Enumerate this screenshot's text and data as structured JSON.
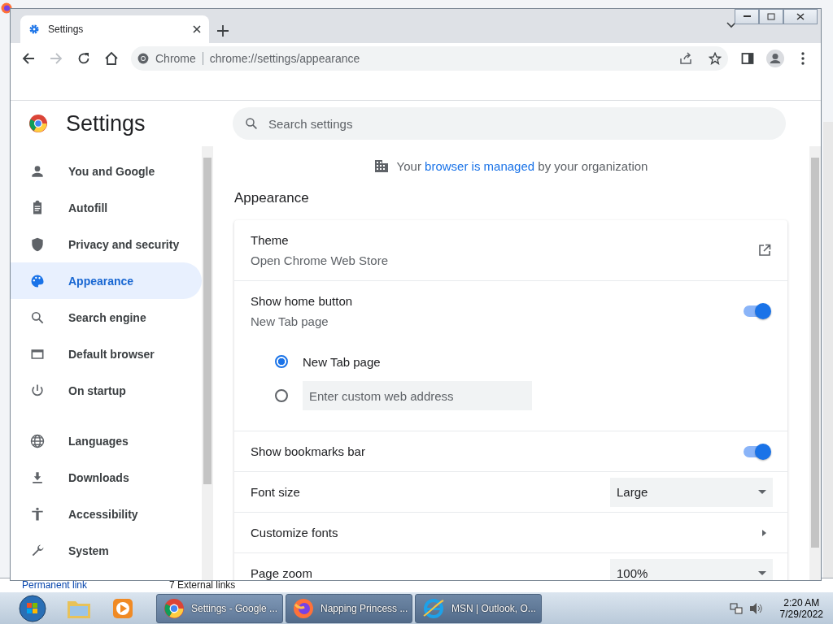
{
  "background_window": {
    "footer_links": [
      "Permanent link",
      "7  External links"
    ]
  },
  "browser": {
    "tab": {
      "title": "Settings"
    },
    "omnibox": {
      "site_label": "Chrome",
      "url": "chrome://settings/appearance"
    }
  },
  "settings": {
    "title": "Settings",
    "search": {
      "placeholder": "Search settings"
    },
    "sidebar": {
      "groups": [
        {
          "items": [
            {
              "label": "You and Google",
              "selected": false
            },
            {
              "label": "Autofill",
              "selected": false
            },
            {
              "label": "Privacy and security",
              "selected": false
            },
            {
              "label": "Appearance",
              "selected": true
            },
            {
              "label": "Search engine",
              "selected": false
            },
            {
              "label": "Default browser",
              "selected": false
            },
            {
              "label": "On startup",
              "selected": false
            }
          ]
        },
        {
          "items": [
            {
              "label": "Languages",
              "selected": false
            },
            {
              "label": "Downloads",
              "selected": false
            },
            {
              "label": "Accessibility",
              "selected": false
            },
            {
              "label": "System",
              "selected": false
            }
          ]
        }
      ]
    },
    "managed_notice": {
      "before": "Your",
      "link": "browser is managed",
      "after": "by your organization"
    },
    "section_title": "Appearance",
    "rows": [
      {
        "kind": "link",
        "title": "Theme",
        "subtitle": "Open Chrome Web Store"
      },
      {
        "kind": "toggle",
        "title": "Show home button",
        "subtitle": "New Tab page",
        "on": true,
        "options": [
          {
            "kind": "radio",
            "label": "New Tab page",
            "selected": true
          },
          {
            "kind": "field",
            "placeholder": "Enter custom web address",
            "selected": false
          }
        ]
      },
      {
        "kind": "toggle",
        "title": "Show bookmarks bar",
        "on": true
      },
      {
        "kind": "select",
        "title": "Font size",
        "value": "Large"
      },
      {
        "kind": "arrow",
        "title": "Customize fonts"
      },
      {
        "kind": "select",
        "title": "Page zoom",
        "value": "100%"
      }
    ]
  },
  "taskbar": {
    "items": [
      {
        "kind": "chrome",
        "label": "Settings - Google ...",
        "selected": true
      },
      {
        "kind": "firefox",
        "label": "Napping Princess ...",
        "selected": false
      },
      {
        "kind": "ie",
        "label": "MSN | Outlook, O...",
        "selected": false
      }
    ],
    "clock": {
      "time": "2:20 AM",
      "date": "7/29/2022"
    }
  }
}
